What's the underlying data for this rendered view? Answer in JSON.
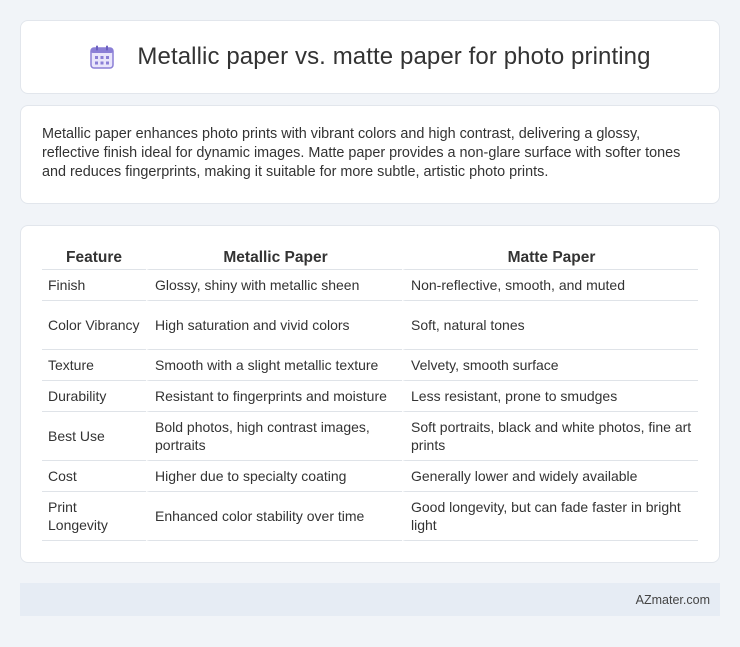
{
  "header": {
    "title": "Metallic paper vs. matte paper for photo printing"
  },
  "intro": {
    "text": "Metallic paper enhances photo prints with vibrant colors and high contrast, delivering a glossy, reflective finish ideal for dynamic images. Matte paper provides a non-glare surface with softer tones and reduces fingerprints, making it suitable for more subtle, artistic photo prints."
  },
  "table": {
    "headers": [
      "Feature",
      "Metallic Paper",
      "Matte Paper"
    ],
    "rows": [
      [
        "Finish",
        "Glossy, shiny with metallic sheen",
        "Non-reflective, smooth, and muted"
      ],
      [
        "Color Vibrancy",
        "High saturation and vivid colors",
        "Soft, natural tones"
      ],
      [
        "Texture",
        "Smooth with a slight metallic texture",
        "Velvety, smooth surface"
      ],
      [
        "Durability",
        "Resistant to fingerprints and moisture",
        "Less resistant, prone to smudges"
      ],
      [
        "Best Use",
        "Bold photos, high contrast images, portraits",
        "Soft portraits, black and white photos, fine art prints"
      ],
      [
        "Cost",
        "Higher due to specialty coating",
        "Generally lower and widely available"
      ],
      [
        "Print Longevity",
        "Enhanced color stability over time",
        "Good longevity, but can fade faster in bright light"
      ]
    ]
  },
  "footer": {
    "brand": "AZmater.com"
  },
  "icons": {
    "title_icon": "calendar-grid-icon"
  },
  "colors": {
    "page_background": "#f1f4f8",
    "card_background": "#ffffff",
    "footer_background": "#e6ecf4",
    "icon_purple": "#8b7fd6"
  }
}
